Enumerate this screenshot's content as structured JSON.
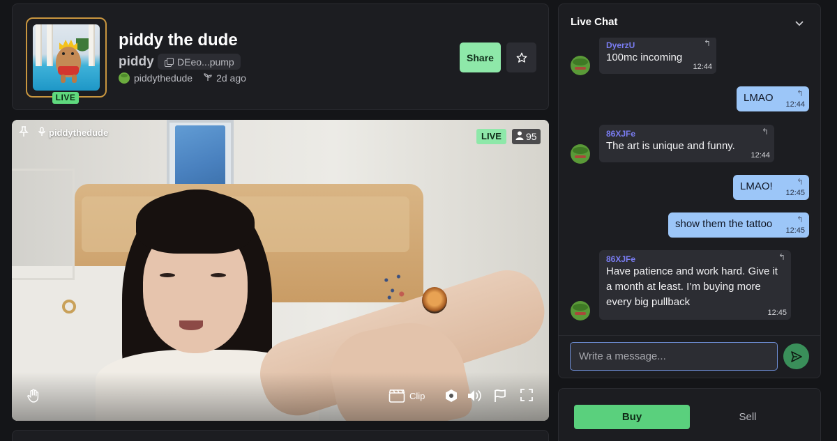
{
  "coin": {
    "name": "piddy the dude",
    "ticker": "piddy",
    "contract_short": "DEeo...pump",
    "creator": "piddythedude",
    "created_ago": "2d ago",
    "live_label": "LIVE"
  },
  "actions": {
    "share_label": "Share",
    "favorite_icon": "star-icon"
  },
  "stream": {
    "streamer": "piddythedude",
    "live_label": "LIVE",
    "viewers": "95",
    "controls": {
      "clip_label": "Clip",
      "icons": [
        "raise-hand-icon",
        "clip-icon",
        "settings-hex-icon",
        "volume-icon",
        "flag-icon",
        "fullscreen-icon",
        "pin-icon",
        "microphone-icon"
      ]
    }
  },
  "chat": {
    "title": "Live Chat",
    "messages": [
      {
        "user": "DyerzU",
        "text": "100mc incoming",
        "time": "12:44",
        "own": false
      },
      {
        "user": "",
        "text": "LMAO",
        "time": "12:44",
        "own": true
      },
      {
        "user": "86XJFe",
        "text": "The art is unique and funny.",
        "time": "12:44",
        "own": false
      },
      {
        "user": "",
        "text": "LMAO!",
        "time": "12:45",
        "own": true
      },
      {
        "user": "",
        "text": "show them the tattoo",
        "time": "12:45",
        "own": true
      },
      {
        "user": "86XJFe",
        "text": "Have patience and work hard. Give it a month at least. I’m buying more every big pullback",
        "time": "12:45",
        "own": false
      }
    ],
    "input_placeholder": "Write a message...",
    "send_icon": "send-icon"
  },
  "trade": {
    "buy_label": "Buy",
    "sell_label": "Sell"
  },
  "colors": {
    "background": "#141518",
    "card": "#1c1d21",
    "accent_green": "#5ad07d",
    "own_bubble": "#9cc6f8",
    "username": "#7a7df3",
    "avatar_border": "#c9963f"
  }
}
